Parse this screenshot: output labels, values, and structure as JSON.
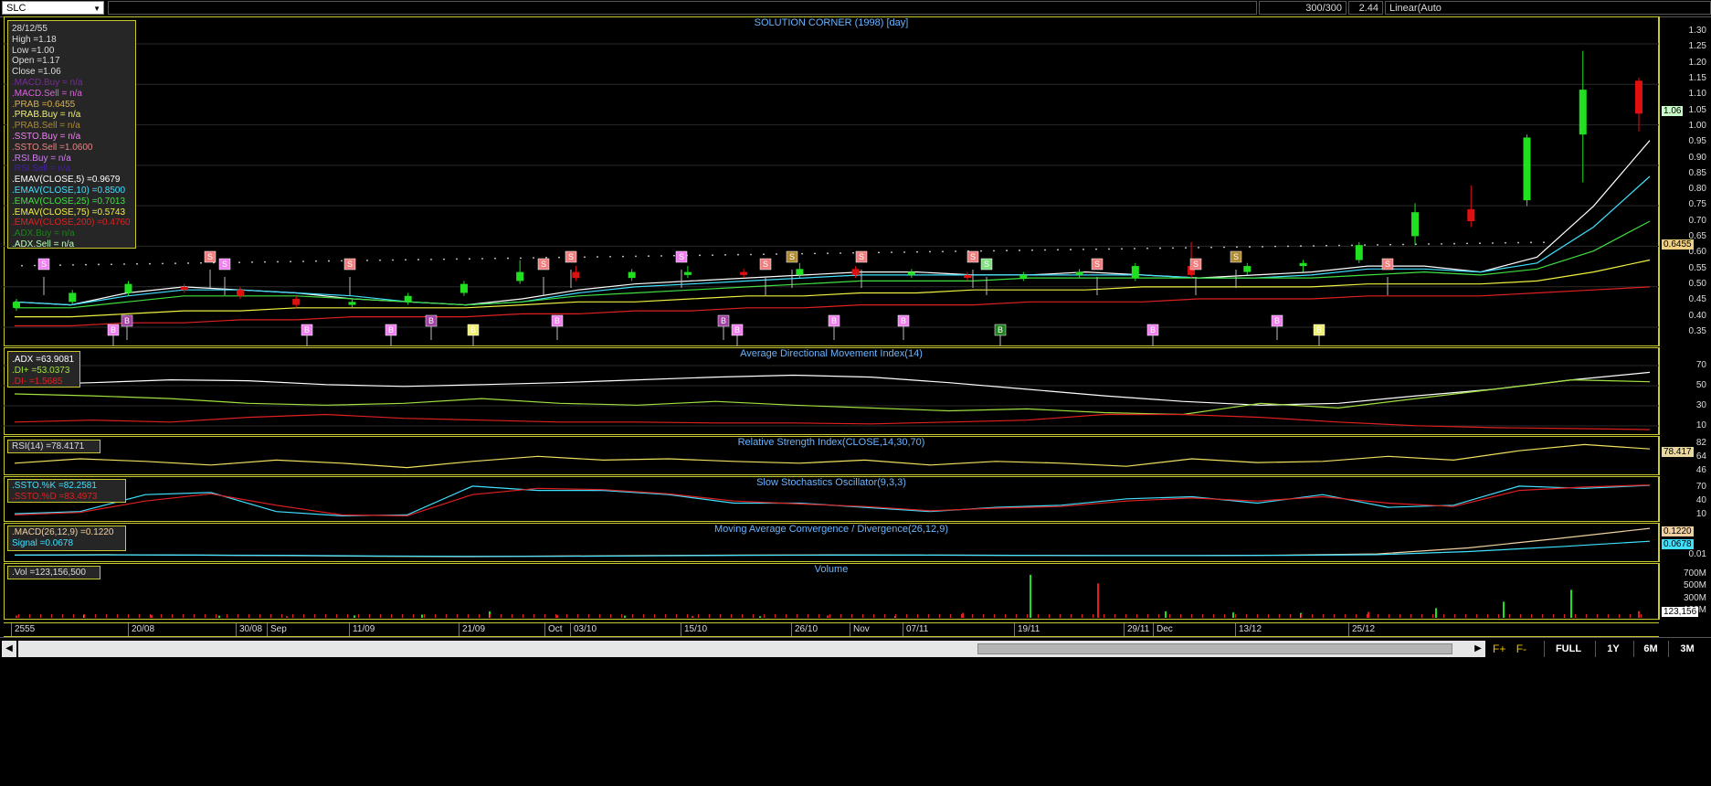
{
  "topbar": {
    "symbol": "SLC",
    "bars": "300/300",
    "last_value": "2.44",
    "scale_mode": "Linear(Auto"
  },
  "chart_title": "SOLUTION CORNER (1998) [day]",
  "info": {
    "date": "28/12/55",
    "high": "High  =1.18",
    "low": "Low   =1.00",
    "open": "Open  =1.17",
    "close": "Close  =1.06",
    "lines": [
      {
        "text": ".MACD.Buy  = n/a",
        "color": "#7a2a9a"
      },
      {
        "text": ".MACD.Sell  = n/a",
        "color": "#e060e0"
      },
      {
        "text": ".PRAB  =0.6455",
        "color": "#d8b050"
      },
      {
        "text": ".PRAB.Buy  = n/a",
        "color": "#f0f070"
      },
      {
        "text": ".PRAB.Sell  = n/a",
        "color": "#b08a30"
      },
      {
        "text": ".SSTO.Buy  = n/a",
        "color": "#f080f0"
      },
      {
        "text": ".SSTO.Sell  =1.0600",
        "color": "#f08080"
      },
      {
        "text": ".RSI.Buy   = n/a",
        "color": "#d080f0"
      },
      {
        "text": ".RSI.Sell  = n/a",
        "color": "#4020a0"
      },
      {
        "text": ".EMAV(CLOSE,5)   =0.9679",
        "color": "#ffffff"
      },
      {
        "text": ".EMAV(CLOSE,10)   =0.8500",
        "color": "#40e0ff"
      },
      {
        "text": ".EMAV(CLOSE,25)   =0.7013",
        "color": "#40e040"
      },
      {
        "text": ".EMAV(CLOSE,75)   =0.5743",
        "color": "#f0f040"
      },
      {
        "text": ".EMAV(CLOSE,200)  =0.4760",
        "color": "#e02020"
      },
      {
        "text": ".ADX.Buy  = n/a",
        "color": "#208020"
      },
      {
        "text": ".ADX.Sell  = n/a",
        "color": "#c0ffc0"
      }
    ]
  },
  "price_axis": [
    "1.30",
    "1.25",
    "1.20",
    "1.15",
    "1.10",
    "1.05",
    "1.00",
    "0.95",
    "0.90",
    "0.85",
    "0.80",
    "0.75",
    "0.70",
    "0.65",
    "0.60",
    "0.55",
    "0.50",
    "0.45",
    "0.40",
    "0.35"
  ],
  "price_tags": [
    {
      "text": "1.06",
      "color": "#c8ffc8"
    },
    {
      "text": "0.6455",
      "color": "#f0d080"
    }
  ],
  "adx": {
    "title": "Average Directional Movement Index(14)",
    "lines": [
      {
        "text": ".ADX   =63.9081",
        "color": "#ffffff"
      },
      {
        "text": ".DI+   =53.0373",
        "color": "#a0e040"
      },
      {
        "text": ".DI-   =1.5685",
        "color": "#e02020"
      }
    ],
    "axis": [
      "70",
      "50",
      "30",
      "10"
    ]
  },
  "rsi": {
    "title": "Relative Strength Index(CLOSE,14,30,70)",
    "label": "RSI(14)   =78.4171",
    "axis": [
      "82",
      "64",
      "46"
    ],
    "tag": "78.417"
  },
  "ssto": {
    "title": "Slow Stochastics Oscillator(9,3,3)",
    "lines": [
      {
        "text": ".SSTO.%K   =82.2581",
        "color": "#40e0ff"
      },
      {
        "text": ".SSTO.%D   =83.4973",
        "color": "#e02020"
      }
    ],
    "axis": [
      "70",
      "40",
      "10"
    ]
  },
  "macd": {
    "title": "Moving Average Convergence / Divergence(26,12,9)",
    "lines": [
      {
        "text": ".MACD(26,12,9)   =0.1220",
        "color": "#f0d0a0"
      },
      {
        "text": "Signal   =0.0678",
        "color": "#40e0ff"
      }
    ],
    "axis": [
      "0.01"
    ],
    "tags": [
      {
        "text": "0.1220",
        "color": "#f0d0a0"
      },
      {
        "text": "0.0678",
        "color": "#40e0ff"
      }
    ]
  },
  "volume": {
    "title": "Volume",
    "label": ".Vol   =123,156,500",
    "axis": [
      "700M",
      "500M",
      "300M",
      "100M"
    ],
    "tag": "123,156"
  },
  "date_axis": [
    "2555",
    "20/08",
    "30/08",
    "Sep",
    "11/09",
    "21/09",
    "Oct",
    "03/10",
    "15/10",
    "26/10",
    "Nov",
    "07/11",
    "19/11",
    "29/11",
    "Dec",
    "13/12",
    "25/12"
  ],
  "range_buttons": [
    "FULL",
    "1Y",
    "6M",
    "3M"
  ],
  "signals": [
    {
      "t": "S",
      "c": "#f080f0"
    },
    {
      "t": "B",
      "c": "#f080f0"
    },
    {
      "t": "B",
      "c": "#a040a0"
    },
    {
      "t": "S",
      "c": "#f08080"
    },
    {
      "t": "S",
      "c": "#f080f0"
    },
    {
      "t": "B",
      "c": "#f080f0"
    },
    {
      "t": "S",
      "c": "#f08080"
    },
    {
      "t": "B",
      "c": "#f080f0"
    },
    {
      "t": "B",
      "c": "#a040a0"
    },
    {
      "t": "B",
      "c": "#f0f070"
    },
    {
      "t": "S",
      "c": "#f08080"
    },
    {
      "t": "S",
      "c": "#f08080"
    },
    {
      "t": "B",
      "c": "#f080f0"
    },
    {
      "t": "S",
      "c": "#f080f0"
    },
    {
      "t": "B",
      "c": "#a040a0"
    },
    {
      "t": "B",
      "c": "#f080f0"
    },
    {
      "t": "S",
      "c": "#f08080"
    },
    {
      "t": "S",
      "c": "#b08a30"
    },
    {
      "t": "B",
      "c": "#f080f0"
    },
    {
      "t": "S",
      "c": "#f08080"
    },
    {
      "t": "B",
      "c": "#f080f0"
    },
    {
      "t": "S",
      "c": "#f08080"
    },
    {
      "t": "S",
      "c": "#80e080"
    },
    {
      "t": "B",
      "c": "#208020"
    },
    {
      "t": "S",
      "c": "#f08080"
    },
    {
      "t": "B",
      "c": "#f080f0"
    },
    {
      "t": "S",
      "c": "#f08080"
    },
    {
      "t": "S",
      "c": "#b08a30"
    },
    {
      "t": "B",
      "c": "#f080f0"
    },
    {
      "t": "B",
      "c": "#f0f070"
    },
    {
      "t": "S",
      "c": "#f08080"
    }
  ],
  "chart_data": {
    "type": "line",
    "title": "SOLUTION CORNER (1998) [day]",
    "ylim": [
      0.33,
      1.33
    ],
    "ema_series": [
      {
        "name": "EMAV(CLOSE,5)",
        "color": "#ffffff",
        "values": [
          0.43,
          0.42,
          0.46,
          0.48,
          0.47,
          0.46,
          0.44,
          0.43,
          0.42,
          0.44,
          0.47,
          0.49,
          0.5,
          0.51,
          0.52,
          0.53,
          0.53,
          0.52,
          0.52,
          0.53,
          0.52,
          0.51,
          0.52,
          0.53,
          0.55,
          0.55,
          0.53,
          0.58,
          0.75,
          0.97
        ]
      },
      {
        "name": "EMAV(CLOSE,10)",
        "color": "#40e0ff",
        "values": [
          0.43,
          0.42,
          0.45,
          0.47,
          0.47,
          0.46,
          0.45,
          0.43,
          0.42,
          0.43,
          0.46,
          0.48,
          0.49,
          0.5,
          0.51,
          0.52,
          0.52,
          0.52,
          0.52,
          0.52,
          0.52,
          0.51,
          0.51,
          0.52,
          0.54,
          0.54,
          0.53,
          0.56,
          0.68,
          0.85
        ]
      },
      {
        "name": "EMAV(CLOSE,25)",
        "color": "#40e040",
        "values": [
          0.41,
          0.41,
          0.43,
          0.45,
          0.45,
          0.45,
          0.44,
          0.43,
          0.42,
          0.43,
          0.45,
          0.46,
          0.47,
          0.48,
          0.49,
          0.5,
          0.5,
          0.5,
          0.51,
          0.51,
          0.51,
          0.51,
          0.51,
          0.51,
          0.52,
          0.53,
          0.52,
          0.54,
          0.6,
          0.7
        ]
      },
      {
        "name": "EMAV(CLOSE,75)",
        "color": "#f0f040",
        "values": [
          0.38,
          0.38,
          0.39,
          0.4,
          0.4,
          0.41,
          0.41,
          0.41,
          0.41,
          0.42,
          0.43,
          0.43,
          0.44,
          0.45,
          0.45,
          0.46,
          0.46,
          0.47,
          0.47,
          0.47,
          0.48,
          0.48,
          0.48,
          0.48,
          0.49,
          0.49,
          0.49,
          0.5,
          0.53,
          0.57
        ]
      },
      {
        "name": "EMAV(CLOSE,200)",
        "color": "#e02020",
        "values": [
          0.35,
          0.35,
          0.36,
          0.36,
          0.37,
          0.37,
          0.38,
          0.38,
          0.38,
          0.39,
          0.39,
          0.4,
          0.4,
          0.41,
          0.41,
          0.42,
          0.42,
          0.42,
          0.43,
          0.43,
          0.43,
          0.44,
          0.44,
          0.44,
          0.45,
          0.45,
          0.45,
          0.46,
          0.47,
          0.48
        ]
      }
    ],
    "candles": [
      {
        "o": 0.41,
        "c": 0.43,
        "h": 0.44,
        "l": 0.4
      },
      {
        "o": 0.43,
        "c": 0.46,
        "h": 0.47,
        "l": 0.42
      },
      {
        "o": 0.46,
        "c": 0.49,
        "h": 0.5,
        "l": 0.45
      },
      {
        "o": 0.48,
        "c": 0.47,
        "h": 0.49,
        "l": 0.46
      },
      {
        "o": 0.47,
        "c": 0.45,
        "h": 0.48,
        "l": 0.44
      },
      {
        "o": 0.44,
        "c": 0.42,
        "h": 0.45,
        "l": 0.41
      },
      {
        "o": 0.42,
        "c": 0.43,
        "h": 0.44,
        "l": 0.41
      },
      {
        "o": 0.43,
        "c": 0.45,
        "h": 0.46,
        "l": 0.42
      },
      {
        "o": 0.46,
        "c": 0.49,
        "h": 0.5,
        "l": 0.45
      },
      {
        "o": 0.5,
        "c": 0.53,
        "h": 0.57,
        "l": 0.49
      },
      {
        "o": 0.53,
        "c": 0.51,
        "h": 0.55,
        "l": 0.5
      },
      {
        "o": 0.51,
        "c": 0.53,
        "h": 0.54,
        "l": 0.5
      },
      {
        "o": 0.52,
        "c": 0.53,
        "h": 0.55,
        "l": 0.51
      },
      {
        "o": 0.53,
        "c": 0.52,
        "h": 0.54,
        "l": 0.51
      },
      {
        "o": 0.52,
        "c": 0.54,
        "h": 0.56,
        "l": 0.51
      },
      {
        "o": 0.54,
        "c": 0.52,
        "h": 0.55,
        "l": 0.51
      },
      {
        "o": 0.52,
        "c": 0.53,
        "h": 0.54,
        "l": 0.51
      },
      {
        "o": 0.52,
        "c": 0.51,
        "h": 0.53,
        "l": 0.5
      },
      {
        "o": 0.51,
        "c": 0.52,
        "h": 0.53,
        "l": 0.5
      },
      {
        "o": 0.52,
        "c": 0.53,
        "h": 0.54,
        "l": 0.51
      },
      {
        "o": 0.51,
        "c": 0.55,
        "h": 0.56,
        "l": 0.5
      },
      {
        "o": 0.55,
        "c": 0.52,
        "h": 0.63,
        "l": 0.51
      },
      {
        "o": 0.53,
        "c": 0.55,
        "h": 0.56,
        "l": 0.52
      },
      {
        "o": 0.55,
        "c": 0.56,
        "h": 0.57,
        "l": 0.53
      },
      {
        "o": 0.57,
        "c": 0.62,
        "h": 0.63,
        "l": 0.56
      },
      {
        "o": 0.65,
        "c": 0.73,
        "h": 0.76,
        "l": 0.62
      },
      {
        "o": 0.74,
        "c": 0.7,
        "h": 0.82,
        "l": 0.68
      },
      {
        "o": 0.77,
        "c": 0.98,
        "h": 0.99,
        "l": 0.75
      },
      {
        "o": 0.99,
        "c": 1.14,
        "h": 1.27,
        "l": 0.83
      },
      {
        "o": 1.17,
        "c": 1.06,
        "h": 1.18,
        "l": 1.0
      }
    ],
    "adx_series": [
      {
        "name": "ADX",
        "color": "#ffffff",
        "values": [
          50,
          52,
          55,
          54,
          50,
          48,
          50,
          52,
          55,
          58,
          60,
          58,
          52,
          45,
          38,
          32,
          28,
          30,
          38,
          45,
          55,
          63
        ]
      },
      {
        "name": "DI+",
        "color": "#a0e040",
        "values": [
          40,
          38,
          35,
          30,
          28,
          30,
          35,
          30,
          28,
          32,
          28,
          25,
          22,
          24,
          20,
          18,
          30,
          25,
          35,
          45,
          55,
          53
        ]
      },
      {
        "name": "DI-",
        "color": "#e02020",
        "values": [
          10,
          12,
          10,
          15,
          18,
          14,
          12,
          10,
          10,
          9,
          9,
          8,
          10,
          12,
          18,
          18,
          15,
          10,
          6,
          4,
          3,
          2
        ]
      }
    ],
    "rsi_series": {
      "name": "RSI(14)",
      "color": "#f0e060",
      "values": [
        55,
        62,
        58,
        52,
        60,
        55,
        48,
        58,
        66,
        60,
        62,
        58,
        55,
        60,
        52,
        58,
        55,
        50,
        62,
        56,
        58,
        66,
        60,
        75,
        85,
        78
      ]
    },
    "ssto_series": [
      {
        "name": "%K",
        "color": "#40e0ff",
        "values": [
          15,
          20,
          60,
          65,
          20,
          10,
          12,
          80,
          70,
          70,
          60,
          40,
          40,
          30,
          20,
          30,
          35,
          50,
          55,
          40,
          60,
          30,
          35,
          80,
          75,
          82
        ]
      },
      {
        "name": "%D",
        "color": "#e02020",
        "values": [
          12,
          18,
          45,
          62,
          35,
          12,
          10,
          60,
          75,
          72,
          62,
          45,
          38,
          32,
          22,
          28,
          32,
          45,
          52,
          45,
          55,
          40,
          32,
          70,
          78,
          83
        ]
      }
    ],
    "macd_series": [
      {
        "name": "MACD",
        "color": "#f0d0a0",
        "values": [
          0.01,
          0.012,
          0.01,
          0.008,
          0.005,
          0.004,
          0.006,
          0.008,
          0.01,
          0.011,
          0.01,
          0.009,
          0.008,
          0.008,
          0.01,
          0.015,
          0.04,
          0.08,
          0.122
        ]
      },
      {
        "name": "Signal",
        "color": "#40e0ff",
        "values": [
          0.01,
          0.011,
          0.01,
          0.009,
          0.006,
          0.005,
          0.005,
          0.007,
          0.009,
          0.01,
          0.01,
          0.009,
          0.008,
          0.008,
          0.009,
          0.012,
          0.025,
          0.045,
          0.068
        ]
      }
    ],
    "volume_bars": [
      {
        "v": 40,
        "c": "#e02020"
      },
      {
        "v": 60,
        "c": "#20e020"
      },
      {
        "v": 50,
        "c": "#e02020"
      },
      {
        "v": 40,
        "c": "#20e020"
      },
      {
        "v": 30,
        "c": "#e02020"
      },
      {
        "v": 45,
        "c": "#20e020"
      },
      {
        "v": 60,
        "c": "#20e020"
      },
      {
        "v": 120,
        "c": "#20e020"
      },
      {
        "v": 50,
        "c": "#e02020"
      },
      {
        "v": 40,
        "c": "#20e020"
      },
      {
        "v": 35,
        "c": "#e02020"
      },
      {
        "v": 30,
        "c": "#20e020"
      },
      {
        "v": 45,
        "c": "#e02020"
      },
      {
        "v": 30,
        "c": "#20e020"
      },
      {
        "v": 90,
        "c": "#e02020"
      },
      {
        "v": 800,
        "c": "#20e020"
      },
      {
        "v": 640,
        "c": "#e02020"
      },
      {
        "v": 120,
        "c": "#20e020"
      },
      {
        "v": 100,
        "c": "#20e020"
      },
      {
        "v": 90,
        "c": "#20e020"
      },
      {
        "v": 110,
        "c": "#e02020"
      },
      {
        "v": 180,
        "c": "#20e020"
      },
      {
        "v": 300,
        "c": "#20e020"
      },
      {
        "v": 520,
        "c": "#20e020"
      },
      {
        "v": 123,
        "c": "#e02020"
      }
    ]
  }
}
